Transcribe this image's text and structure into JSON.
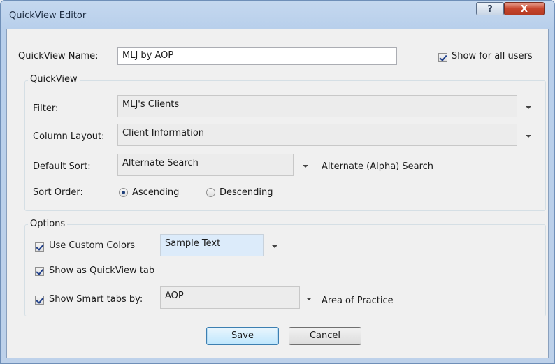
{
  "window": {
    "title": "QuickView Editor",
    "help_glyph": "?",
    "close_glyph": "X"
  },
  "name_field": {
    "label": "QuickView Name:",
    "value": "MLJ by AOP"
  },
  "show_all_users": {
    "label": "Show for all users",
    "checked": true
  },
  "quickview_group": {
    "title": "QuickView",
    "filter": {
      "label": "Filter:",
      "value": "MLJ's Clients"
    },
    "column_layout": {
      "label": "Column Layout:",
      "value": "Client Information"
    },
    "default_sort": {
      "label": "Default Sort:",
      "value": "Alternate Search",
      "description": "Alternate (Alpha) Search"
    },
    "sort_order": {
      "label": "Sort Order:",
      "options": [
        "Ascending",
        "Descending"
      ],
      "selected": "Ascending"
    }
  },
  "options_group": {
    "title": "Options",
    "use_custom_colors": {
      "label": "Use Custom Colors",
      "checked": true,
      "sample": "Sample Text",
      "sample_bg": "#dcebfa"
    },
    "show_as_tab": {
      "label": "Show as QuickView tab",
      "checked": true
    },
    "smart_tabs": {
      "label": "Show Smart tabs by:",
      "checked": true,
      "value": "AOP",
      "description": "Area of Practice"
    }
  },
  "buttons": {
    "save": "Save",
    "cancel": "Cancel"
  },
  "colors": {
    "title_bar": "#bdd1ea",
    "dialog_bg": "#f0f0f0",
    "close_button": "#c7452c"
  }
}
